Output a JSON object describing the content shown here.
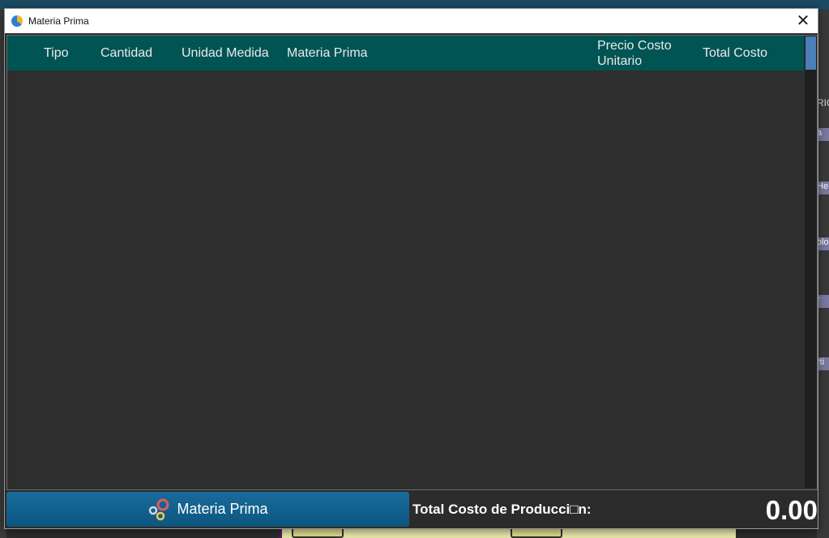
{
  "window": {
    "title": "Materia Prima",
    "close_glyph": "✕"
  },
  "table": {
    "columns": [
      "Tipo",
      "Cantidad",
      "Unidad Medida",
      "Materia Prima",
      "Precio Costo Unitario",
      "Total Costo"
    ],
    "rows": []
  },
  "footer": {
    "button_label": "Materia Prima",
    "button_icon": "gears-icon",
    "total_label": "Total Costo de Producci□n:",
    "total_value": "0.00"
  },
  "background": {
    "right_chips": [
      "a",
      "He",
      "olo",
      "r",
      "rti"
    ],
    "right_text": "RIC"
  },
  "colors": {
    "header_bg": "#005454",
    "button_bg": "#0c567f",
    "scroll_thumb": "#4a7fb8",
    "panel_bg": "#2b2b2b"
  }
}
